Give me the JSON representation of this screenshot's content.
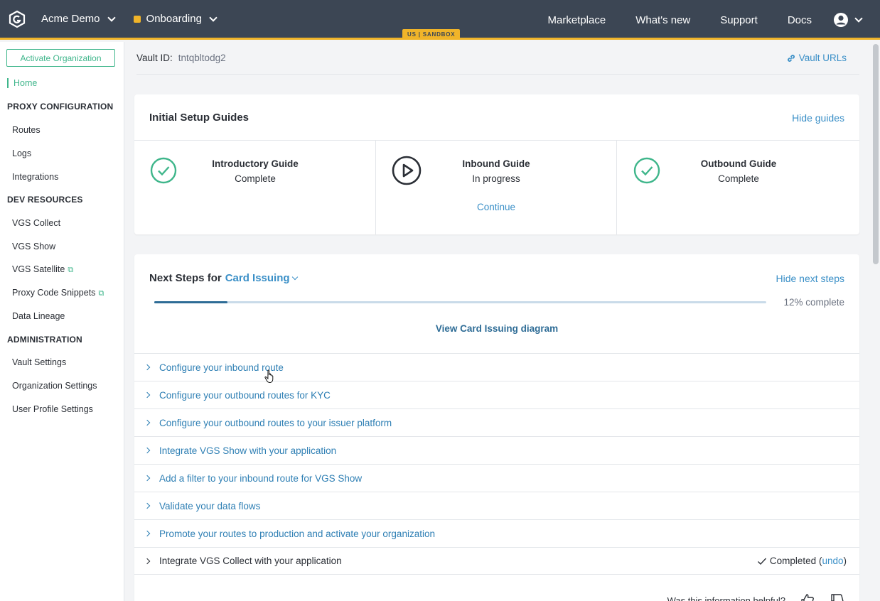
{
  "topbar": {
    "org_name": "Acme Demo",
    "environment": "Onboarding",
    "region_badge": "US | SANDBOX",
    "nav": [
      "Marketplace",
      "What's new",
      "Support",
      "Docs"
    ],
    "env_color": "#f0b429"
  },
  "sidebar": {
    "activate_button": "Activate Organization",
    "home": "Home",
    "sections": [
      {
        "title": "PROXY CONFIGURATION",
        "items": [
          "Routes",
          "Logs",
          "Integrations"
        ]
      },
      {
        "title": "DEV RESOURCES",
        "items": [
          "VGS Collect",
          "VGS Show",
          "VGS Satellite",
          "Proxy Code Snippets",
          "Data Lineage"
        ]
      },
      {
        "title": "ADMINISTRATION",
        "items": [
          "Vault Settings",
          "Organization Settings",
          "User Profile Settings"
        ]
      }
    ]
  },
  "vault": {
    "label": "Vault ID:",
    "id": "tntqbltodg2",
    "urls_link": "Vault URLs"
  },
  "guides": {
    "title": "Initial Setup Guides",
    "hide_link": "Hide guides",
    "items": [
      {
        "title": "Introductory Guide",
        "status": "Complete",
        "icon": "check-circle-icon"
      },
      {
        "title": "Inbound Guide",
        "status": "In progress",
        "action": "Continue",
        "icon": "play-circle-icon"
      },
      {
        "title": "Outbound Guide",
        "status": "Complete",
        "icon": "check-circle-icon"
      }
    ]
  },
  "next_steps": {
    "title_prefix": "Next Steps for",
    "track": "Card Issuing",
    "hide_link": "Hide next steps",
    "progress_percent": 12,
    "progress_label": "12% complete",
    "diagram_link": "View Card Issuing diagram",
    "steps": [
      "Configure your inbound route",
      "Configure your outbound routes for KYC",
      "Configure your outbound routes to your issuer platform",
      "Integrate VGS Show with your application",
      "Add a filter to your inbound route for VGS Show",
      "Validate your data flows",
      "Promote your routes to production and activate your organization"
    ],
    "completed_step": "Integrate VGS Collect with your application",
    "completed_label": "Completed (",
    "undo_label": "undo",
    "completed_close": ")",
    "helpful_text": "Was this information helpful?"
  },
  "colors": {
    "accent_green": "#3fb68b",
    "link_blue": "#3a8fc7",
    "topbar": "#3c4654"
  }
}
